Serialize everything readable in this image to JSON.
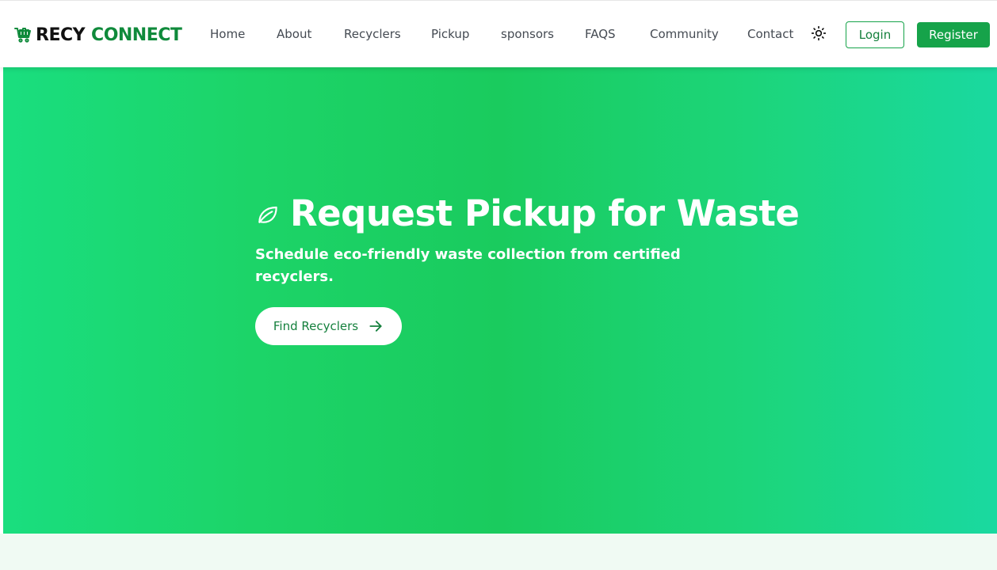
{
  "brand": {
    "icon": "cart-recycle-icon",
    "name_part1": "RECY",
    "name_part2": "CONNECT"
  },
  "nav": {
    "links": [
      {
        "label": "Home"
      },
      {
        "label": "About"
      },
      {
        "label": "Recyclers"
      },
      {
        "label": "Pickup"
      },
      {
        "label": "sponsors"
      },
      {
        "label": "FAQS"
      },
      {
        "label": "Community"
      },
      {
        "label": "Contact"
      }
    ],
    "theme_toggle_icon": "sun-icon",
    "login_label": "Login",
    "register_label": "Register"
  },
  "hero": {
    "icon": "leaf-icon",
    "title": "Request Pickup for Waste",
    "subtitle": "Schedule eco-friendly waste collection from certified recyclers.",
    "cta_label": "Find Recyclers",
    "cta_icon": "arrow-right-icon"
  },
  "colors": {
    "brand_green": "#16a34a",
    "dark_green": "#15803d",
    "hero_gradient_start": "#1ade7f",
    "hero_gradient_mid": "#1acb5e",
    "hero_gradient_end": "#1ad9a0"
  }
}
